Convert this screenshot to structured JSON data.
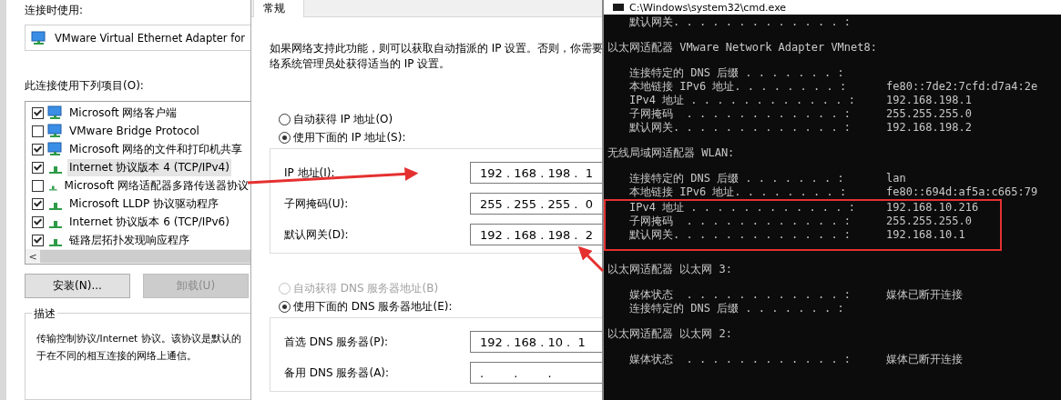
{
  "adapter_dialog": {
    "connect_using_label": "连接时使用:",
    "adapter": "VMware Virtual Ethernet Adapter for",
    "items_label": "此连接使用下列项目(O):",
    "items": [
      {
        "label": "Microsoft 网络客户端",
        "kind": "client",
        "checked": true,
        "selected": false
      },
      {
        "label": "VMware Bridge Protocol",
        "kind": "client",
        "checked": false,
        "selected": false
      },
      {
        "label": "Microsoft 网络的文件和打印机共享",
        "kind": "client",
        "checked": true,
        "selected": false
      },
      {
        "label": "Internet 协议版本 4 (TCP/IPv4)",
        "kind": "protocol",
        "checked": true,
        "selected": true
      },
      {
        "label": "Microsoft 网络适配器多路传送器协议",
        "kind": "protocol",
        "checked": false,
        "selected": false
      },
      {
        "label": "Microsoft LLDP 协议驱动程序",
        "kind": "protocol",
        "checked": true,
        "selected": false
      },
      {
        "label": "Internet 协议版本 6 (TCP/IPv6)",
        "kind": "protocol",
        "checked": true,
        "selected": false
      },
      {
        "label": "链路层拓扑发现响应程序",
        "kind": "protocol",
        "checked": true,
        "selected": false
      }
    ],
    "scroll_left": "<",
    "buttons": [
      {
        "label": "安装(N)...",
        "disabled": false
      },
      {
        "label": "卸载(U)",
        "disabled": true
      }
    ],
    "description_title": "描述",
    "description_lines": [
      "传输控制协议/Internet 协议。该协议是默认的",
      "于在不同的相互连接的网络上通信。"
    ]
  },
  "ipv4_dialog": {
    "tabs": [
      {
        "label": "常规",
        "selected": true
      }
    ],
    "intro_lines": [
      "如果网络支持此功能，则可以获取自动指派的 IP 设置。否则，你需要",
      "络系统管理员处获得适当的 IP 设置。"
    ],
    "ip_radios": [
      {
        "label": "自动获得 IP 地址(O)",
        "selected": false,
        "disabled": false
      },
      {
        "label": "使用下面的 IP 地址(S):",
        "selected": true,
        "disabled": false
      }
    ],
    "ip_fields": [
      {
        "label": "IP 地址(I):",
        "value": "192 . 168 . 198 .  1"
      },
      {
        "label": "子网掩码(U):",
        "value": "255 . 255 . 255 .  0"
      },
      {
        "label": "默认网关(D):",
        "value": "192 . 168 . 198 .  2"
      }
    ],
    "dns_radios": [
      {
        "label": "自动获得 DNS 服务器地址(B)",
        "selected": false,
        "disabled": true
      },
      {
        "label": "使用下面的 DNS 服务器地址(E):",
        "selected": true,
        "disabled": false
      }
    ],
    "dns_fields": [
      {
        "label": "首选 DNS 服务器(P):",
        "value": "192 . 168 . 10 .  1"
      },
      {
        "label": "备用 DNS 服务器(A):",
        "value": ".        .        ."
      }
    ]
  },
  "cmd": {
    "title": "C:\\Windows\\system32\\cmd.exe",
    "lines": [
      {
        "kind": "entry",
        "label": "默认网关. . . . . . . . . . . . . :",
        "highlighted": false
      },
      {
        "kind": "header",
        "label": "以太网适配器 VMware Network Adapter VMnet8:",
        "highlighted": false
      },
      {
        "kind": "entry",
        "label": "连接特定的 DNS 后缀 . . . . . . . :",
        "highlighted": false
      },
      {
        "kind": "entry",
        "label": "本地链接 IPv6 地址. . . . . . . . :",
        "value": "fe80::7de2:7cfd:d7a4:2e",
        "highlighted": false
      },
      {
        "kind": "entry",
        "label": "IPv4 地址 . . . . . . . . . . . . :",
        "value": "192.168.198.1",
        "highlighted": false
      },
      {
        "kind": "entry",
        "label": "子网掩码  . . . . . . . . . . . . :",
        "value": "255.255.255.0",
        "highlighted": false
      },
      {
        "kind": "entry",
        "label": "默认网关. . . . . . . . . . . . . :",
        "value": "192.168.198.2",
        "highlighted": false
      },
      {
        "kind": "header",
        "label": "无线局域网适配器 WLAN:",
        "highlighted": false
      },
      {
        "kind": "entry",
        "label": "连接特定的 DNS 后缀 . . . . . . . :",
        "value": "lan",
        "highlighted": false
      },
      {
        "kind": "entry",
        "label": "本地链接 IPv6 地址. . . . . . . . :",
        "value": "fe80::694d:af5a:c665:79",
        "highlighted": false
      },
      {
        "kind": "entry",
        "label": "IPv4 地址 . . . . . . . . . . . . :",
        "value": "192.168.10.216",
        "highlighted": true
      },
      {
        "kind": "entry",
        "label": "子网掩码  . . . . . . . . . . . . :",
        "value": "255.255.255.0",
        "highlighted": true
      },
      {
        "kind": "entry",
        "label": "默认网关. . . . . . . . . . . . . :",
        "value": "192.168.10.1",
        "highlighted": true
      },
      {
        "kind": "header",
        "label": "以太网适配器 以太网 3:",
        "highlighted": false
      },
      {
        "kind": "entry",
        "label": "媒体状态  . . . . . . . . . . . . :",
        "value": "媒体已断开连接",
        "highlighted": false
      },
      {
        "kind": "entry",
        "label": "连接特定的 DNS 后缀 . . . . . . . :",
        "highlighted": false
      },
      {
        "kind": "header",
        "label": "以太网适配器 以太网 2:",
        "highlighted": false
      },
      {
        "kind": "entry",
        "label": "媒体状态  . . . . . . . . . . . . :",
        "value": "媒体已断开连接",
        "highlighted": false
      }
    ]
  }
}
